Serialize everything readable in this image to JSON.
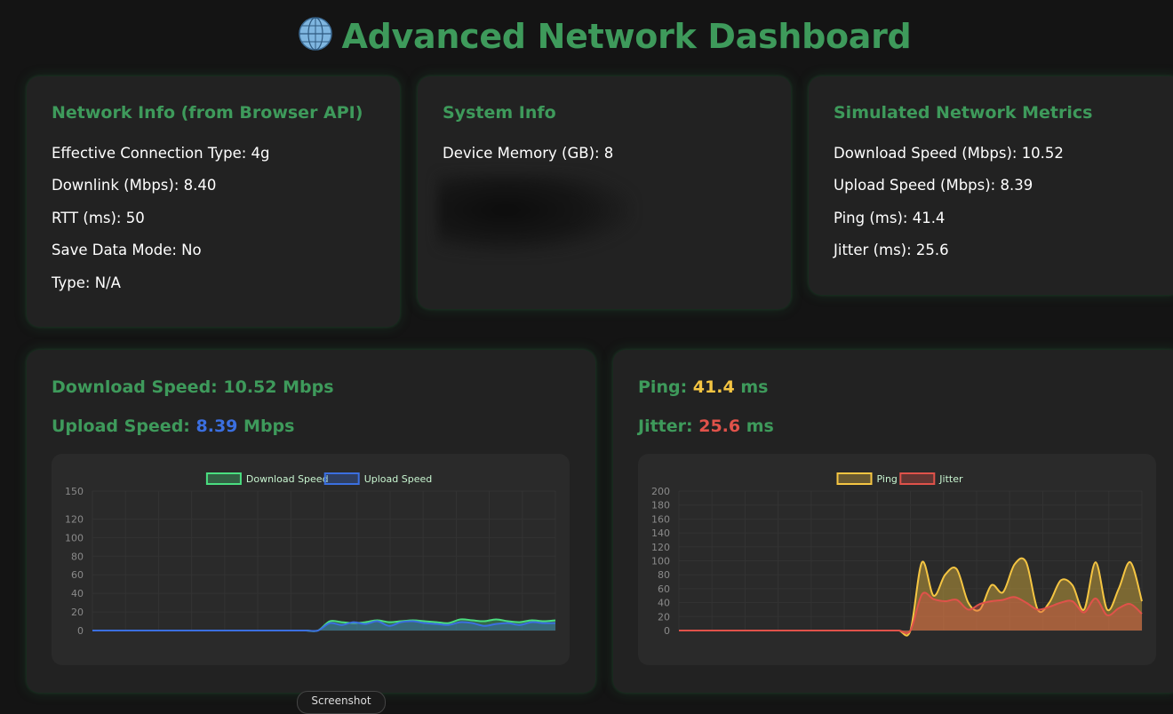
{
  "header": {
    "icon": "globe-icon",
    "title": "Advanced Network Dashboard"
  },
  "network_info": {
    "title": "Network Info (from Browser API)",
    "rows": [
      "Effective Connection Type: 4g",
      "Downlink (Mbps): 8.40",
      "RTT (ms): 50",
      "Save Data Mode: No",
      "Type: N/A"
    ]
  },
  "system_info": {
    "title": "System Info",
    "rows": [
      "Device Memory (GB): 8"
    ]
  },
  "simulated": {
    "title": "Simulated Network Metrics",
    "rows": [
      "Download Speed (Mbps): 10.52",
      "Upload Speed (Mbps): 8.39",
      "Ping (ms): 41.4",
      "Jitter (ms): 25.6"
    ]
  },
  "speed_panel": {
    "download_label": "Download Speed:",
    "download_value": "10.52",
    "download_unit": "Mbps",
    "upload_label": "Upload Speed:",
    "upload_value": "8.39",
    "upload_unit": "Mbps"
  },
  "latency_panel": {
    "ping_label": "Ping:",
    "ping_value": "41.4",
    "ping_unit": "ms",
    "jitter_label": "Jitter:",
    "jitter_value": "25.6",
    "jitter_unit": "ms"
  },
  "colors": {
    "accent": "#3e9a5b",
    "download": "#4ade80",
    "upload": "#3b6fe0",
    "ping": "#f5c542",
    "jitter": "#e0524a"
  },
  "screenshot_button": "Screenshot",
  "chart_data": [
    {
      "type": "line",
      "legend": [
        "Download Speed",
        "Upload Speed"
      ],
      "y_ticks": [
        0,
        20,
        40,
        60,
        80,
        100,
        120,
        150
      ],
      "ylim": [
        0,
        150
      ],
      "series": [
        {
          "name": "Download Speed",
          "color": "#4ade80",
          "values": [
            0,
            0,
            0,
            0,
            0,
            0,
            0,
            0,
            0,
            0,
            0,
            0,
            0,
            0,
            0,
            0,
            0,
            0,
            0,
            0,
            10,
            9,
            8,
            9,
            11,
            9,
            10,
            11,
            10,
            9,
            8,
            12,
            11,
            10,
            12,
            10,
            9,
            11,
            10,
            11
          ]
        },
        {
          "name": "Upload Speed",
          "color": "#3b6fe0",
          "values": [
            0,
            0,
            0,
            0,
            0,
            0,
            0,
            0,
            0,
            0,
            0,
            0,
            0,
            0,
            0,
            0,
            0,
            0,
            0,
            0,
            8,
            6,
            9,
            7,
            10,
            5,
            9,
            10,
            8,
            7,
            6,
            9,
            8,
            5,
            7,
            8,
            6,
            9,
            8,
            8
          ]
        }
      ]
    },
    {
      "type": "area",
      "legend": [
        "Ping",
        "Jitter"
      ],
      "y_ticks": [
        0,
        20,
        40,
        60,
        80,
        100,
        120,
        140,
        160,
        180,
        200
      ],
      "ylim": [
        0,
        200
      ],
      "series": [
        {
          "name": "Ping",
          "color": "#f5c542",
          "values": [
            0,
            0,
            0,
            0,
            0,
            0,
            0,
            0,
            0,
            0,
            0,
            0,
            0,
            0,
            0,
            0,
            0,
            0,
            0,
            0,
            0,
            98,
            50,
            80,
            88,
            40,
            30,
            65,
            55,
            95,
            98,
            30,
            40,
            72,
            65,
            30,
            98,
            30,
            60,
            98,
            42
          ]
        },
        {
          "name": "Jitter",
          "color": "#e0524a",
          "values": [
            0,
            0,
            0,
            0,
            0,
            0,
            0,
            0,
            0,
            0,
            0,
            0,
            0,
            0,
            0,
            0,
            0,
            0,
            0,
            0,
            0,
            52,
            45,
            42,
            44,
            30,
            38,
            42,
            44,
            48,
            40,
            30,
            34,
            40,
            42,
            26,
            46,
            22,
            32,
            38,
            24
          ]
        }
      ]
    }
  ]
}
